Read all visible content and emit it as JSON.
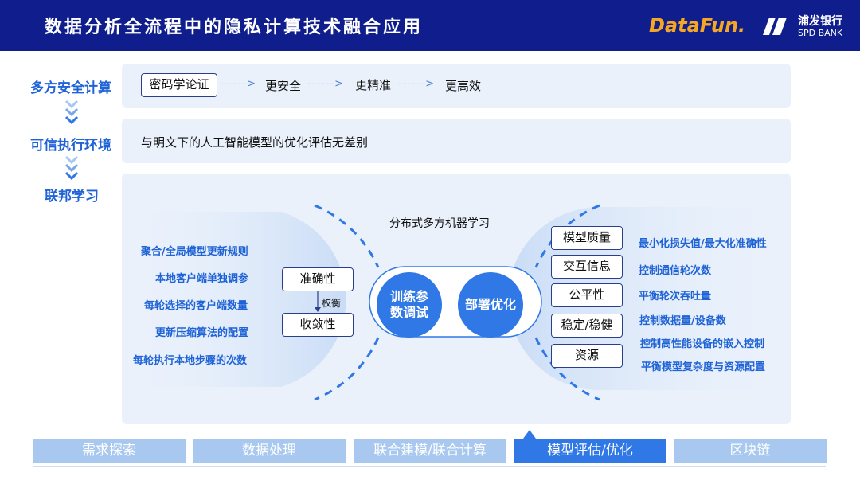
{
  "header": {
    "title": "数据分析全流程中的隐私计算技术融合应用",
    "logo_datafun": "DataFun.",
    "logo_spd_cn": "浦发银行",
    "logo_spd_en": "SPD BANK"
  },
  "left_labels": [
    "多方安全计算",
    "可信执行环境",
    "联邦学习"
  ],
  "row1": {
    "boxed": "密码学论证",
    "items": [
      "更安全",
      "更精准",
      "更高效"
    ],
    "arrow": "------>"
  },
  "row2": {
    "text": "与明文下的人工智能模型的优化评估无差别"
  },
  "fl": {
    "center_title": "分布式多方机器学习",
    "left_items": [
      "聚合/全局模型更新规则",
      "本地客户端单独调参",
      "每轮选择的客户端数量",
      "更新压缩算法的配置",
      "每轮执行本地步骤的次数"
    ],
    "mid_boxes": [
      "准确性",
      "收敛性"
    ],
    "tradeoff": "权衡",
    "circle_left": "训练参数调试",
    "circle_right": "部署优化",
    "right_boxes": [
      "模型质量",
      "交互信息",
      "公平性",
      "稳定/稳健",
      "资源"
    ],
    "right_items": [
      "最小化损失值/最大化准确性",
      "控制通信轮次数",
      "平衡轮次吞吐量",
      "控制数据量/设备数",
      "控制高性能设备的嵌入控制",
      "平衡模型复杂度与资源配置"
    ]
  },
  "tabs": [
    {
      "label": "需求探索",
      "active": false
    },
    {
      "label": "数据处理",
      "active": false
    },
    {
      "label": "联合建模/联合计算",
      "active": false
    },
    {
      "label": "模型评估/优化",
      "active": true
    },
    {
      "label": "区块链",
      "active": false
    }
  ],
  "colors": {
    "header": "#0f1e8c",
    "accent": "#2f78e6",
    "label": "#1f63d6",
    "tab_inactive": "#a8c8ef"
  }
}
